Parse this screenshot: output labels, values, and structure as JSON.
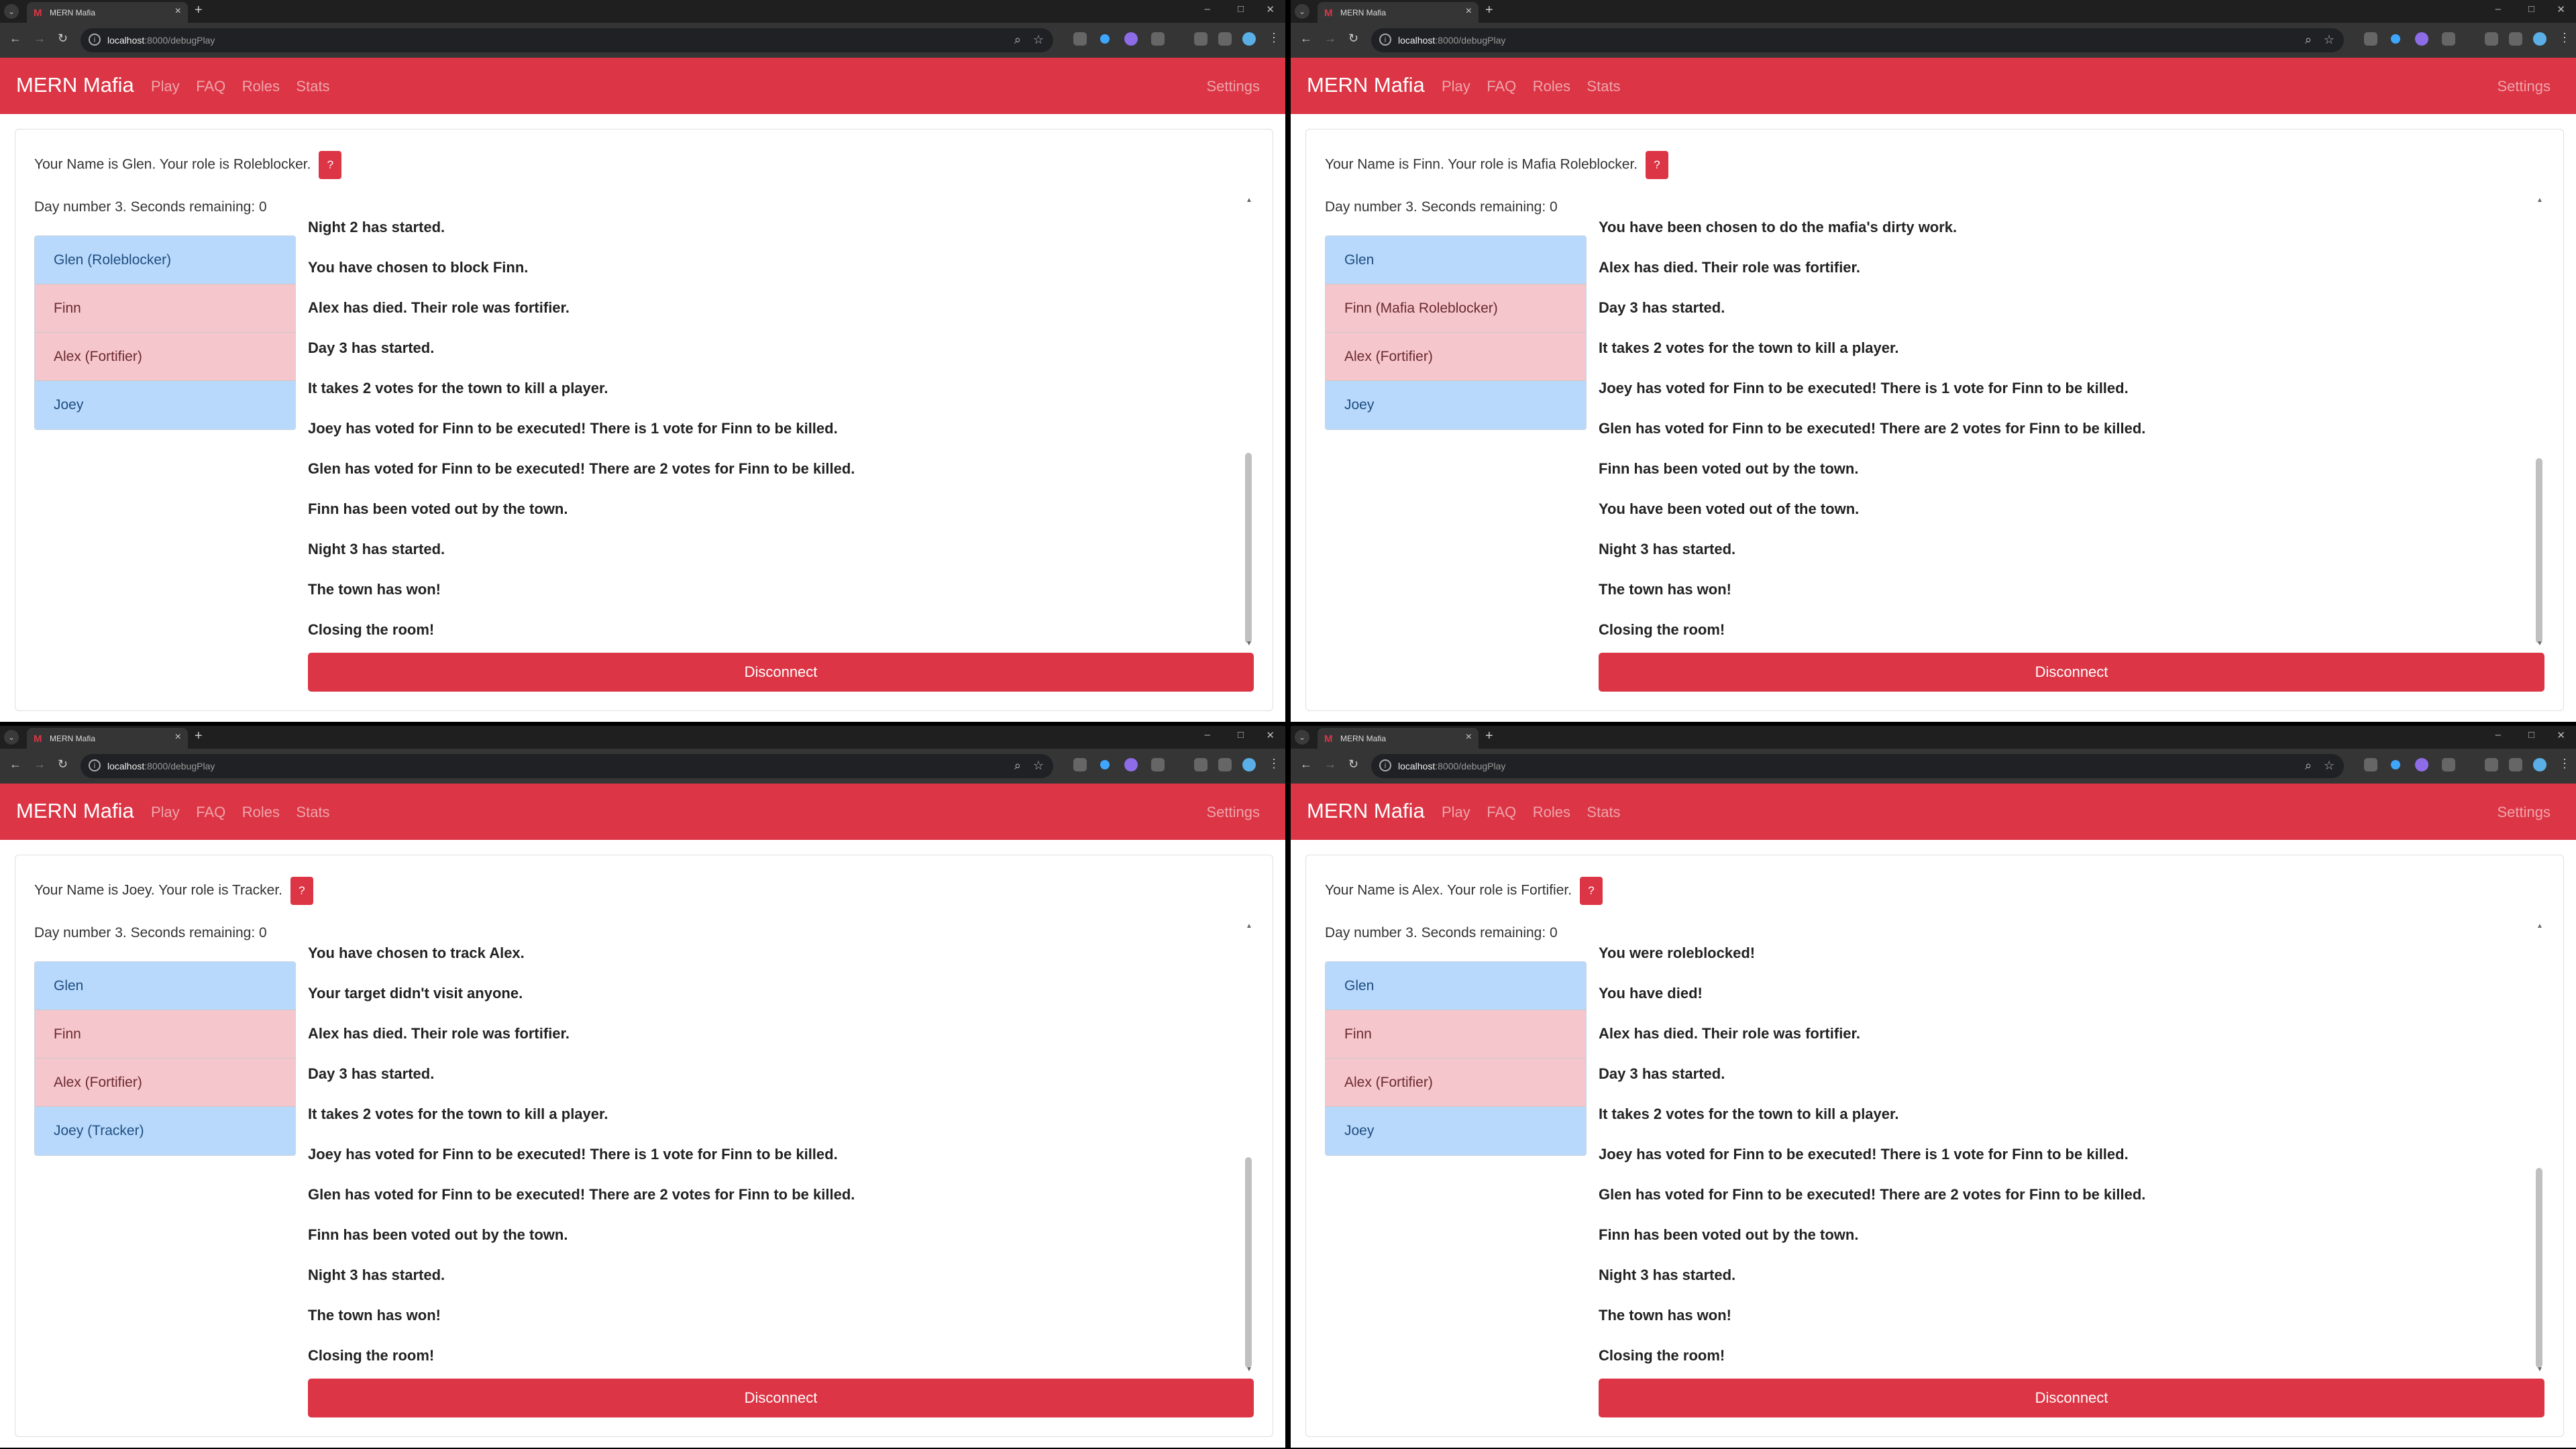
{
  "browser": {
    "tab_title": "MERN Mafia",
    "url_host": "localhost",
    "url_path": ":8000/debugPlay"
  },
  "nav": {
    "brand": "MERN Mafia",
    "links": [
      "Play",
      "FAQ",
      "Roles",
      "Stats"
    ],
    "settings": "Settings"
  },
  "colors": {
    "accent": "#dc3545",
    "town": "#b8d9fb",
    "mafia": "#f5c6cb"
  },
  "windows": [
    {
      "role_text": "Your Name is Glen. Your role is Roleblocker.",
      "day_text": "Day number 3. Seconds remaining: 0",
      "help_label": "?",
      "players": [
        {
          "name": "Glen (Roleblocker)",
          "team": "town"
        },
        {
          "name": "Finn",
          "team": "mafia"
        },
        {
          "name": "Alex (Fortifier)",
          "team": "mafia"
        },
        {
          "name": "Joey",
          "team": "town"
        }
      ],
      "messages": [
        "Night 2 has started.",
        "You have chosen to block Finn.",
        "Alex has died. Their role was fortifier.",
        "Day 3 has started.",
        "It takes 2 votes for the town to kill a player.",
        "Joey has voted for Finn to be executed! There is 1 vote for Finn to be killed.",
        "Glen has voted for Finn to be executed! There are 2 votes for Finn to be killed.",
        "Finn has been voted out by the town.",
        "Night 3 has started.",
        "The town has won!",
        "Closing the room!"
      ],
      "disconnect_label": "Disconnect"
    },
    {
      "role_text": "Your Name is Finn. Your role is Mafia Roleblocker.",
      "day_text": "Day number 3. Seconds remaining: 0",
      "help_label": "?",
      "players": [
        {
          "name": "Glen",
          "team": "town"
        },
        {
          "name": "Finn (Mafia Roleblocker)",
          "team": "mafia"
        },
        {
          "name": "Alex (Fortifier)",
          "team": "mafia"
        },
        {
          "name": "Joey",
          "team": "town"
        }
      ],
      "messages": [
        "You have been chosen to do the mafia's dirty work.",
        "Alex has died. Their role was fortifier.",
        "Day 3 has started.",
        "It takes 2 votes for the town to kill a player.",
        "Joey has voted for Finn to be executed! There is 1 vote for Finn to be killed.",
        "Glen has voted for Finn to be executed! There are 2 votes for Finn to be killed.",
        "Finn has been voted out by the town.",
        "You have been voted out of the town.",
        "Night 3 has started.",
        "The town has won!",
        "Closing the room!"
      ],
      "disconnect_label": "Disconnect"
    },
    {
      "role_text": "Your Name is Joey. Your role is Tracker.",
      "day_text": "Day number 3. Seconds remaining: 0",
      "help_label": "?",
      "players": [
        {
          "name": "Glen",
          "team": "town"
        },
        {
          "name": "Finn",
          "team": "mafia"
        },
        {
          "name": "Alex (Fortifier)",
          "team": "mafia"
        },
        {
          "name": "Joey (Tracker)",
          "team": "town"
        }
      ],
      "messages": [
        "You have chosen to track Alex.",
        "Your target didn't visit anyone.",
        "Alex has died. Their role was fortifier.",
        "Day 3 has started.",
        "It takes 2 votes for the town to kill a player.",
        "Joey has voted for Finn to be executed! There is 1 vote for Finn to be killed.",
        "Glen has voted for Finn to be executed! There are 2 votes for Finn to be killed.",
        "Finn has been voted out by the town.",
        "Night 3 has started.",
        "The town has won!",
        "Closing the room!"
      ],
      "disconnect_label": "Disconnect"
    },
    {
      "role_text": "Your Name is Alex. Your role is Fortifier.",
      "day_text": "Day number 3. Seconds remaining: 0",
      "help_label": "?",
      "players": [
        {
          "name": "Glen",
          "team": "town"
        },
        {
          "name": "Finn",
          "team": "mafia"
        },
        {
          "name": "Alex (Fortifier)",
          "team": "mafia"
        },
        {
          "name": "Joey",
          "team": "town"
        }
      ],
      "messages": [
        "You were roleblocked!",
        "You have died!",
        "Alex has died. Their role was fortifier.",
        "Day 3 has started.",
        "It takes 2 votes for the town to kill a player.",
        "Joey has voted for Finn to be executed! There is 1 vote for Finn to be killed.",
        "Glen has voted for Finn to be executed! There are 2 votes for Finn to be killed.",
        "Finn has been voted out by the town.",
        "Night 3 has started.",
        "The town has won!",
        "Closing the room!"
      ],
      "disconnect_label": "Disconnect"
    }
  ]
}
